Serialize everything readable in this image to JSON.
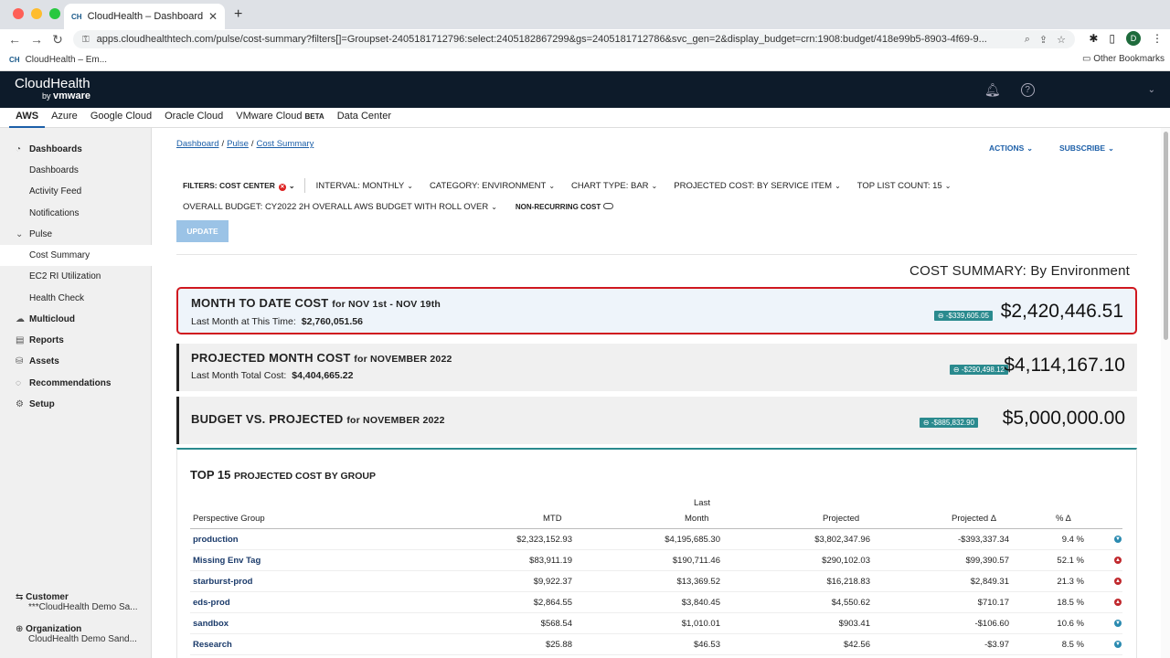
{
  "browser": {
    "tab_title": "CloudHealth – Dashboard / Pulse",
    "tab_favicon": "CH",
    "url": "apps.cloudhealthtech.com/pulse/cost-summary?filters[]=Groupset-2405181712796:select:2405182867299&gs=2405181712786&svc_gen=2&display_budget=crn:1908:budget/418e99b5-8903-4f69-9...",
    "bookmark": "CloudHealth – Em...",
    "other_bookmarks": "Other Bookmarks",
    "avatar": "D"
  },
  "app": {
    "logo_main": "CloudHealth",
    "logo_by": "by",
    "logo_brand": "vmware"
  },
  "cloud_tabs": [
    {
      "label": "AWS"
    },
    {
      "label": "Azure"
    },
    {
      "label": "Google Cloud"
    },
    {
      "label": "Oracle Cloud"
    },
    {
      "label": "VMware Cloud",
      "badge": "BETA"
    },
    {
      "label": "Data Center"
    }
  ],
  "sidebar": {
    "items": [
      {
        "label": "Dashboards"
      },
      {
        "label": "Dashboards"
      },
      {
        "label": "Activity Feed"
      },
      {
        "label": "Notifications"
      },
      {
        "label": "Pulse"
      },
      {
        "label": "Cost Summary"
      },
      {
        "label": "EC2 RI Utilization"
      },
      {
        "label": "Health Check"
      },
      {
        "label": "Multicloud"
      },
      {
        "label": "Reports"
      },
      {
        "label": "Assets"
      },
      {
        "label": "Recommendations"
      },
      {
        "label": "Setup"
      }
    ],
    "customer_label": "Customer",
    "customer_value": "***CloudHealth Demo Sa...",
    "org_label": "Organization",
    "org_value": "CloudHealth Demo Sand..."
  },
  "breadcrumb": {
    "dashboard": "Dashboard",
    "pulse": "Pulse",
    "current": "Cost Summary"
  },
  "header_actions": {
    "actions": "ACTIONS",
    "subscribe": "SUBSCRIBE"
  },
  "filters": {
    "filters": "FILTERS: COST CENTER",
    "interval_label": "INTERVAL:",
    "interval_value": "MONTHLY",
    "category_label": "CATEGORY:",
    "category_value": "ENVIRONMENT",
    "chart_type_label": "CHART TYPE:",
    "chart_type_value": "BAR",
    "projected_label": "PROJECTED COST:",
    "projected_value": "BY SERVICE ITEM",
    "toplist_label": "TOP LIST COUNT:",
    "toplist_value": "15",
    "budget_label": "OVERALL BUDGET:",
    "budget_value": "CY2022 2H OVERALL AWS BUDGET WITH ROLL OVER",
    "nonrecurring": "NON-RECURRING COST",
    "update_button": "UPDATE"
  },
  "cost_summary_title": "COST SUMMARY: By Environment",
  "cards": {
    "mtd": {
      "title": "MONTH TO DATE COST",
      "period": "for NOV 1st - NOV 19th",
      "sub_label": "Last Month at This Time:",
      "sub_value": "$2,760,051.56",
      "badge": "-$339,605.05",
      "amount": "$2,420,446.51"
    },
    "projected": {
      "title": "PROJECTED MONTH COST",
      "period": "for NOVEMBER 2022",
      "sub_label": "Last Month Total Cost:",
      "sub_value": "$4,404,665.22",
      "badge": "-$290,498.12",
      "amount": "$4,114,167.10"
    },
    "budget": {
      "title": "BUDGET VS. PROJECTED",
      "period": "for NOVEMBER 2022",
      "badge": "-$885,832.90",
      "amount": "$5,000,000.00"
    }
  },
  "table": {
    "title": "TOP 15",
    "title_rest": "PROJECTED COST BY GROUP",
    "headers": {
      "group": "Perspective Group",
      "mtd": "MTD",
      "last_1": "Last",
      "last_2": "Month",
      "projected": "Projected",
      "delta": "Projected Δ",
      "pct": "% Δ"
    },
    "rows": [
      {
        "group": "production",
        "mtd": "$2,323,152.93",
        "last": "$4,195,685.30",
        "projected": "$3,802,347.96",
        "delta": "-$393,337.34",
        "pct": "9.4 %",
        "trend": "down"
      },
      {
        "group": "Missing Env Tag",
        "mtd": "$83,911.19",
        "last": "$190,711.46",
        "projected": "$290,102.03",
        "delta": "$99,390.57",
        "pct": "52.1 %",
        "trend": "up"
      },
      {
        "group": "starburst-prod",
        "mtd": "$9,922.37",
        "last": "$13,369.52",
        "projected": "$16,218.83",
        "delta": "$2,849.31",
        "pct": "21.3 %",
        "trend": "up"
      },
      {
        "group": "eds-prod",
        "mtd": "$2,864.55",
        "last": "$3,840.45",
        "projected": "$4,550.62",
        "delta": "$710.17",
        "pct": "18.5 %",
        "trend": "up"
      },
      {
        "group": "sandbox",
        "mtd": "$568.54",
        "last": "$1,010.01",
        "projected": "$903.41",
        "delta": "-$106.60",
        "pct": "10.6 %",
        "trend": "down"
      },
      {
        "group": "Research",
        "mtd": "$25.88",
        "last": "$46.53",
        "projected": "$42.56",
        "delta": "-$3.97",
        "pct": "8.5 %",
        "trend": "down"
      }
    ]
  },
  "colors": {
    "header_bg": "#0d1b2a",
    "accent": "#1c5fa8",
    "badge": "#2a8a8e",
    "highlight_border": "#d0181f",
    "trend_up": "#c0282d",
    "trend_down": "#2a8ab0"
  }
}
